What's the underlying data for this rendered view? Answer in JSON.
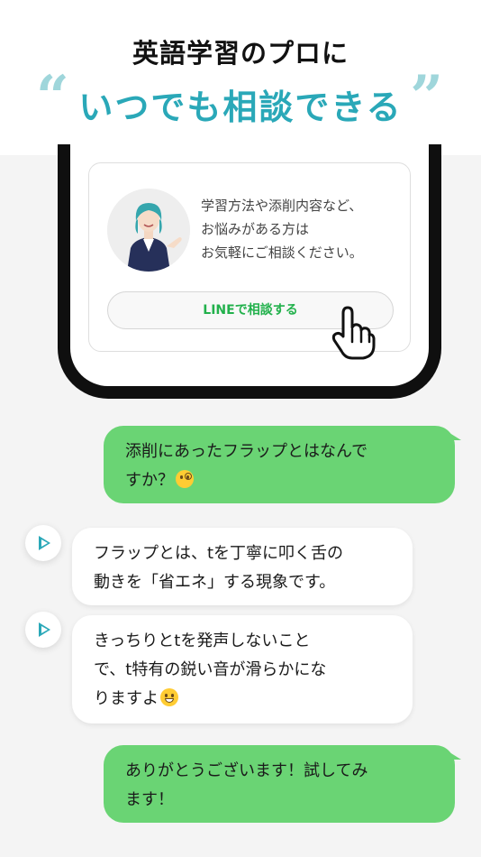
{
  "header": {
    "headline": "英語学習のプロに",
    "tagline": "いつでも相談できる",
    "quote_open": "“",
    "quote_close": "”"
  },
  "consult_card": {
    "lines": [
      "学習方法や添削内容など、",
      "お悩みがある方は",
      "お気軽にご相談ください。"
    ],
    "button_label": "LINEで相談する",
    "accent_color": "#22b14c"
  },
  "chat": {
    "messages": [
      {
        "sender": "user",
        "lines": [
          "添削にあったフラップとはなんで",
          "すか？"
        ],
        "emoji": "face-with-monocle"
      },
      {
        "sender": "agent",
        "lines": [
          "フラップとは、tを丁寧に叩く舌の",
          "動きを「省エネ」する現象です。"
        ]
      },
      {
        "sender": "agent",
        "lines": [
          "きっちりとtを発声しないこと",
          "で、t特有の鋭い音が滑らかにな",
          "りますよ"
        ],
        "emoji": "grinning-face"
      },
      {
        "sender": "user",
        "lines": [
          "ありがとうございます！試してみ",
          "ます！"
        ]
      }
    ],
    "user_bubble_color": "#6ad474",
    "agent_bubble_color": "#ffffff",
    "play_icon_color": "#2aa8b8"
  }
}
